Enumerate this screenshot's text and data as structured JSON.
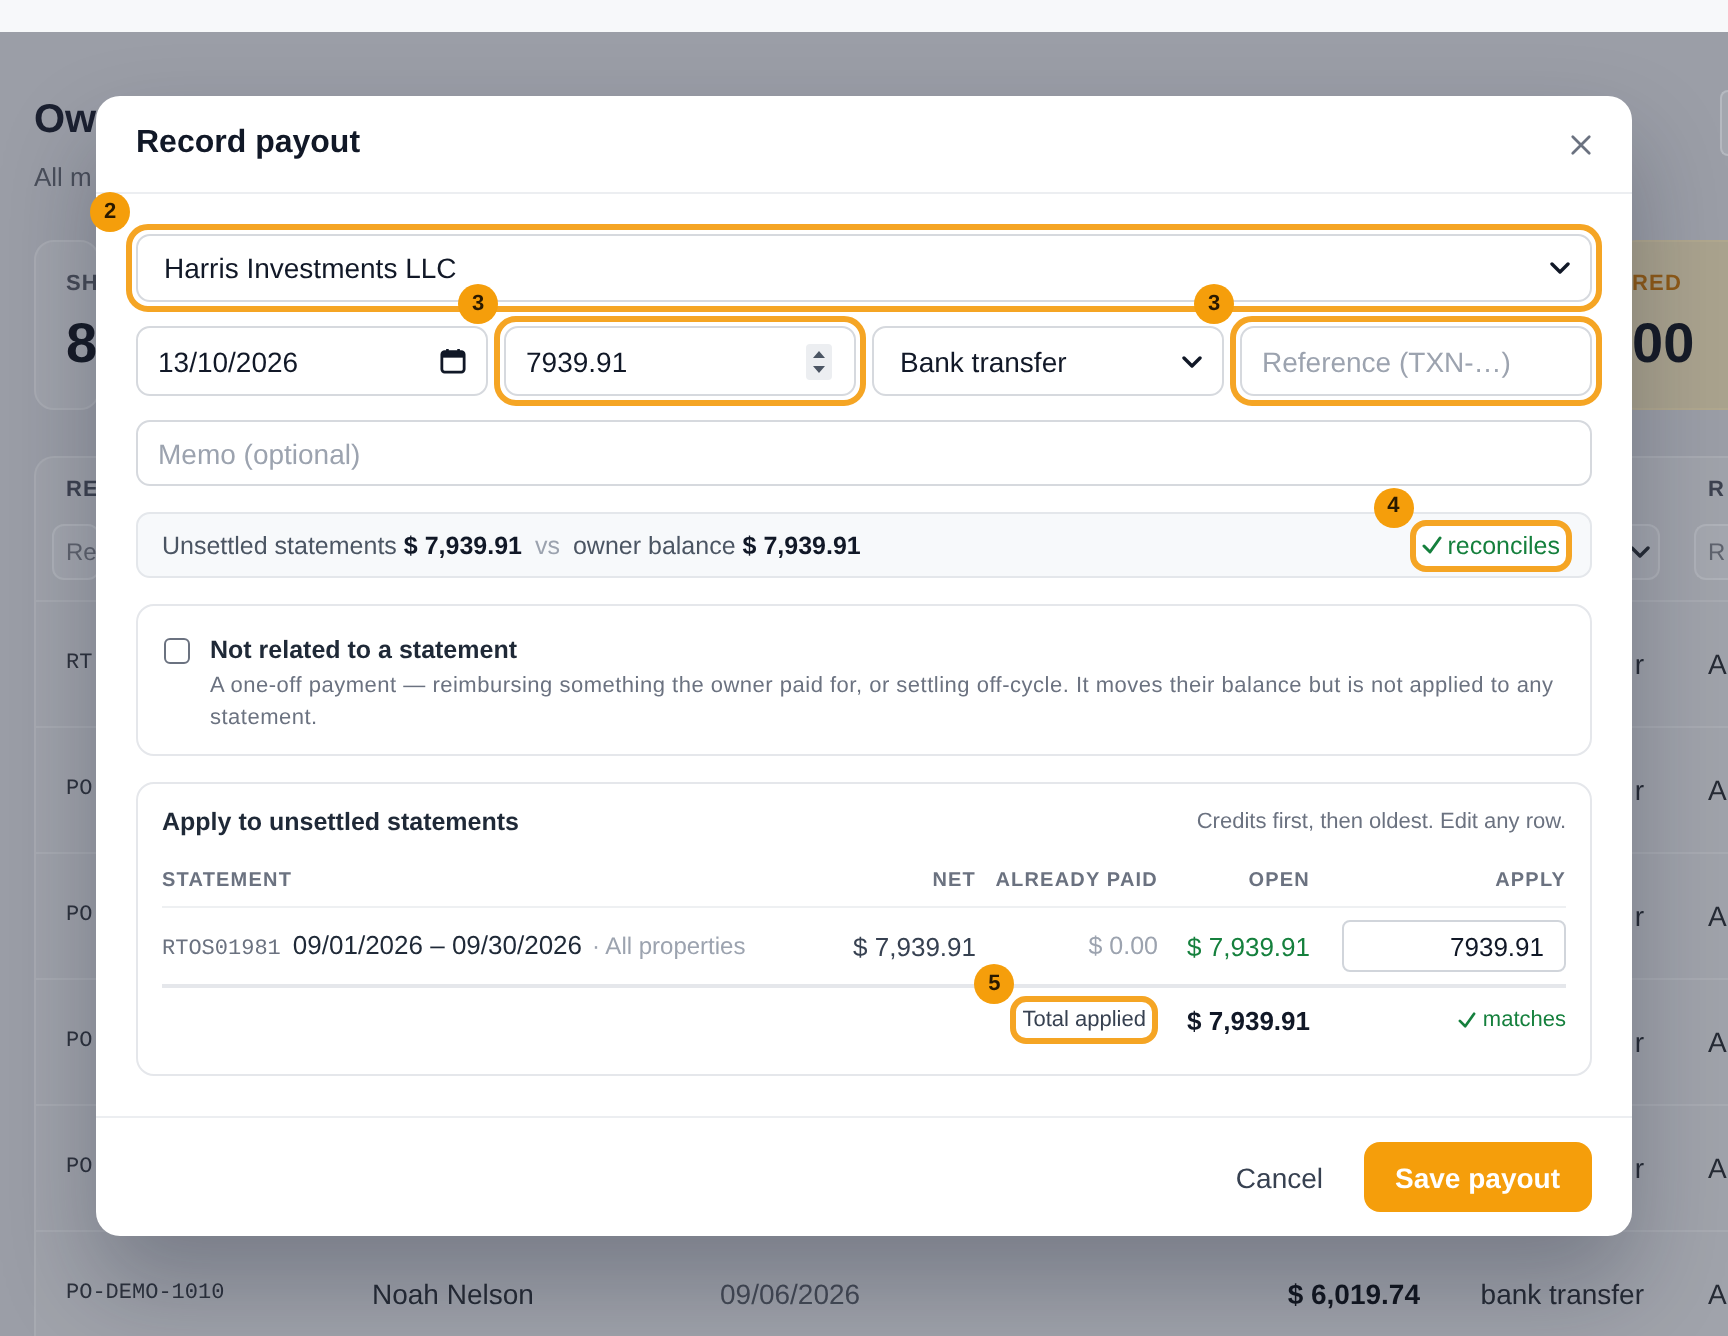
{
  "page": {
    "title": "Ow",
    "subtitle": "All m",
    "stat_cards": [
      {
        "kind": "neutral",
        "label": "SH",
        "value": "8"
      },
      {
        "kind": "warning",
        "label": "RED",
        "value": "00"
      }
    ],
    "table": {
      "columns": {
        "column_1": {
          "label": "RE",
          "filter": {
            "kind": "input",
            "placeholder": "Re"
          }
        },
        "column_5": {
          "filter": {
            "kind": "select"
          }
        },
        "column_6": {
          "label": "R",
          "filter": {
            "kind": "input",
            "placeholder": "R"
          }
        }
      },
      "rows": [
        {
          "column_1": "RT",
          "column_5": "r",
          "column_6": "A"
        },
        {
          "column_1": "PO",
          "column_5": "r",
          "column_6": "A"
        },
        {
          "column_1": "PO",
          "column_5": "r",
          "column_6": "A"
        },
        {
          "column_1": "PO",
          "column_5": "r",
          "column_6": "A"
        },
        {
          "column_1": "PO",
          "column_5": "r",
          "column_6": "A"
        },
        {
          "column_1": "PO-DEMO-1010",
          "column_2": "Noah Nelson",
          "column_3": "09/06/2026",
          "column_4": "$ 6,019.74",
          "column_5": "bank transfer",
          "column_6": "A"
        }
      ]
    }
  },
  "dialog": {
    "title": "Record payout",
    "owner_select": {
      "value": "Harris Investments LLC",
      "callout": "2"
    },
    "date_field": {
      "value": "13/10/2026"
    },
    "amount_field": {
      "value": "7939.91",
      "callout": "3"
    },
    "method_select": {
      "value": "Bank transfer"
    },
    "reference_field": {
      "placeholder": "Reference (TXN-…)",
      "callout": "3"
    },
    "memo_field": {
      "placeholder": "Memo (optional)"
    },
    "summary": {
      "statements_label": "Unsettled statements",
      "statements_total": "$ 7,939.91",
      "separator": "vs",
      "balance_label": "owner balance",
      "balance_total": "$ 7,939.91"
    },
    "reconcile_status": {
      "label": "reconciles",
      "ok": true,
      "callout": "4"
    },
    "standalone_option": {
      "checked": false,
      "title": "Not related to a statement",
      "description": "A one-off payment — reimbursing something the owner paid for, or settling off-cycle. It moves their balance but is not applied to any statement."
    },
    "apply_section": {
      "title": "Apply to unsettled statements",
      "hint": "Credits first, then oldest. Edit any row.",
      "columns": [
        "STATEMENT",
        "NET",
        "ALREADY PAID",
        "OPEN",
        "APPLY"
      ],
      "rows": [
        {
          "statement_id": "RTOS01981",
          "period": "09/01/2026 – 09/30/2026",
          "scope": "· All properties",
          "net": "$ 7,939.91",
          "already_paid": "$ 0.00",
          "open": "$ 7,939.91",
          "apply": "7939.91"
        }
      ],
      "total": {
        "label": "Total applied",
        "value": "$ 7,939.91",
        "callout": "5",
        "status": {
          "label": "matches",
          "ok": true
        }
      }
    },
    "buttons": [
      {
        "kind": "secondary",
        "label": "Cancel"
      },
      {
        "kind": "primary",
        "label": "Save payout"
      }
    ]
  }
}
